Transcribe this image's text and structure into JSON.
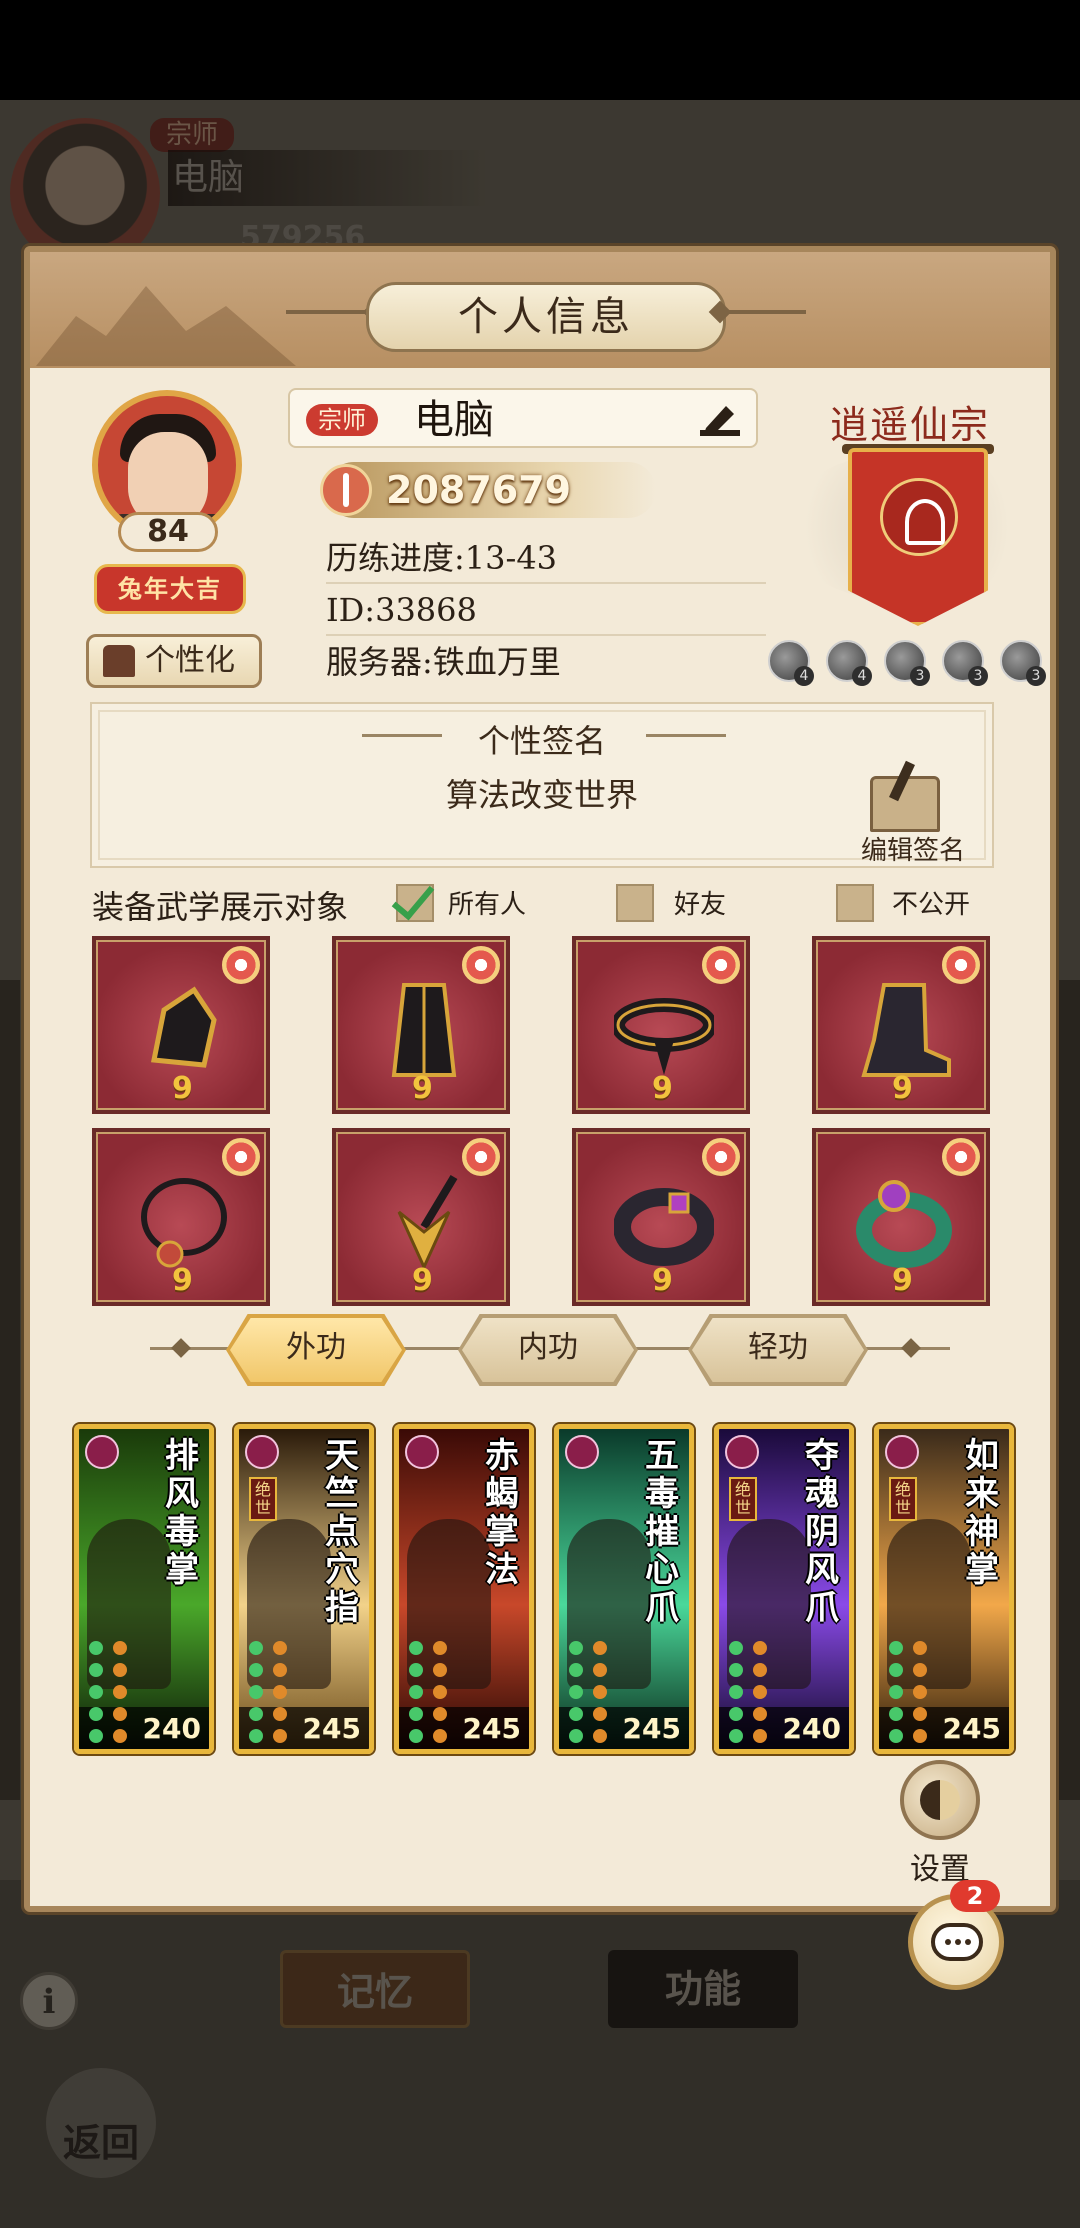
{
  "background": {
    "rank": "宗师",
    "name": "电脑",
    "coins": "579256",
    "tabs": [
      "记忆",
      "功能"
    ],
    "info_icon": "i",
    "back_label": "返回"
  },
  "dialog": {
    "title": "个人信息",
    "profile": {
      "level": "84",
      "badge": "兔年大吉",
      "personalize_label": "个性化",
      "rank": "宗师",
      "name": "电脑",
      "power": "2087679",
      "progress": "历练进度:13-43",
      "id": "ID:33868",
      "server": "服务器:铁血万里"
    },
    "sect": {
      "name": "逍遥仙宗",
      "icons": [
        {
          "icon": "sect-badge-icon-1",
          "count": "4"
        },
        {
          "icon": "sect-badge-icon-2",
          "count": "4"
        },
        {
          "icon": "sect-badge-icon-3",
          "count": "3"
        },
        {
          "icon": "sect-badge-icon-4",
          "count": "3"
        },
        {
          "icon": "sect-badge-icon-5",
          "count": "3"
        }
      ]
    },
    "signature": {
      "title": "个性签名",
      "text": "算法改变世界",
      "edit_label": "编辑签名"
    },
    "display": {
      "label": "装备武学展示对象",
      "options": [
        {
          "label": "所有人",
          "checked": true
        },
        {
          "label": "好友",
          "checked": false
        },
        {
          "label": "不公开",
          "checked": false
        }
      ]
    },
    "equipment": [
      {
        "item": "gauntlet-icon",
        "level": "9"
      },
      {
        "item": "robe-icon",
        "level": "9"
      },
      {
        "item": "belt-icon",
        "level": "9"
      },
      {
        "item": "boots-icon",
        "level": "9"
      },
      {
        "item": "necklace-icon",
        "level": "9"
      },
      {
        "item": "hairpin-icon",
        "level": "9"
      },
      {
        "item": "bracelet-icon",
        "level": "9"
      },
      {
        "item": "jade-ring-icon",
        "level": "9"
      }
    ],
    "martial_tabs": [
      "外功",
      "内功",
      "轻功"
    ],
    "active_tab": "外功",
    "skills": [
      {
        "name": "排风毒掌",
        "tag": "",
        "power": "240",
        "color": "#2c6a1a"
      },
      {
        "name": "天竺点穴指",
        "tag": "绝世",
        "power": "245",
        "color": "#c89a3a"
      },
      {
        "name": "赤蝎掌法",
        "tag": "",
        "power": "245",
        "color": "#8a2a18"
      },
      {
        "name": "五毒摧心爪",
        "tag": "",
        "power": "245",
        "color": "#2a8a5a"
      },
      {
        "name": "夺魂阴风爪",
        "tag": "绝世",
        "power": "240",
        "color": "#5a2a9a"
      },
      {
        "name": "如来神掌",
        "tag": "绝世",
        "power": "245",
        "color": "#c8782a"
      }
    ],
    "settings_label": "设置",
    "chat_badge": "2"
  }
}
